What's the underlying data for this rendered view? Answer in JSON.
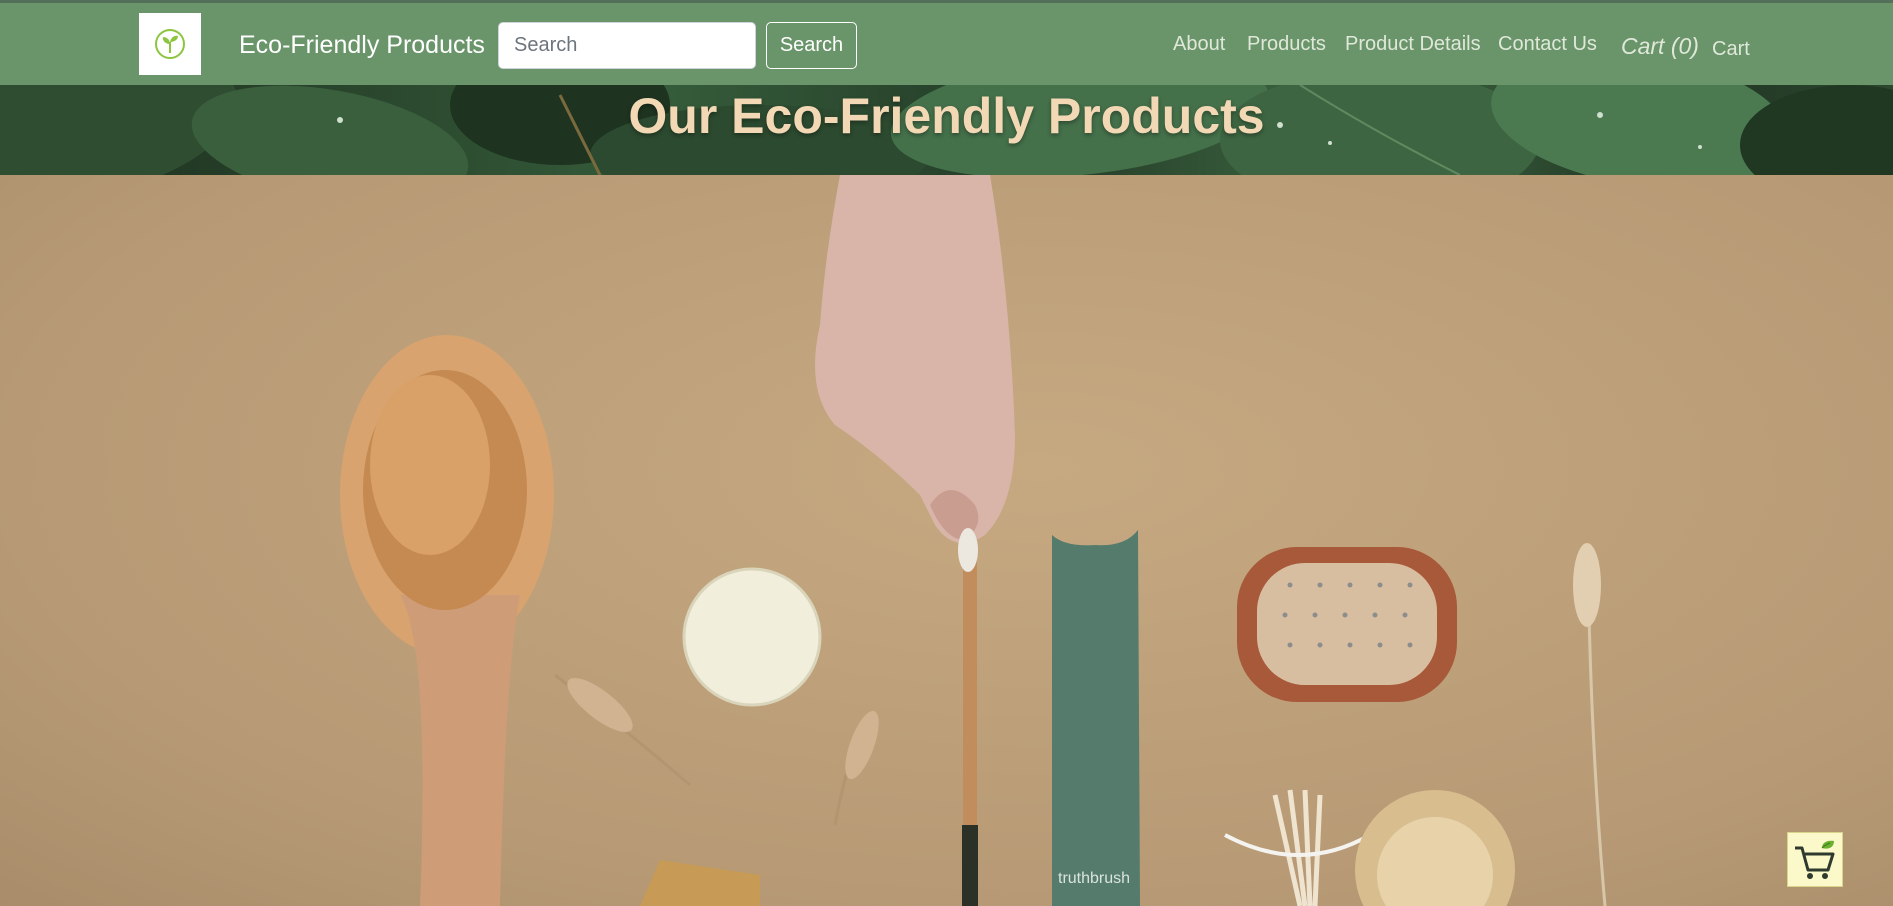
{
  "navbar": {
    "brand": "Eco-Friendly Products",
    "logo_icon": "sprout-icon",
    "search": {
      "placeholder": "Search",
      "value": "",
      "button_label": "Search"
    },
    "links": [
      {
        "label": "About"
      },
      {
        "label": "Products"
      },
      {
        "label": "Product Details"
      },
      {
        "label": "Contact Us"
      }
    ],
    "cart": {
      "count_label": "Cart (0)",
      "text": "Cart"
    }
  },
  "banner": {
    "title": "Our Eco-Friendly Products"
  },
  "hero": {
    "tube_brand": "truthbrush"
  },
  "floating_cart": {
    "icon": "shopping-cart-icon"
  },
  "colors": {
    "navbar_bg": "#6a956a",
    "banner_title": "#f3d8b5",
    "hero_bg": "#c6a981",
    "float_cart_bg": "#fbf8c9"
  }
}
